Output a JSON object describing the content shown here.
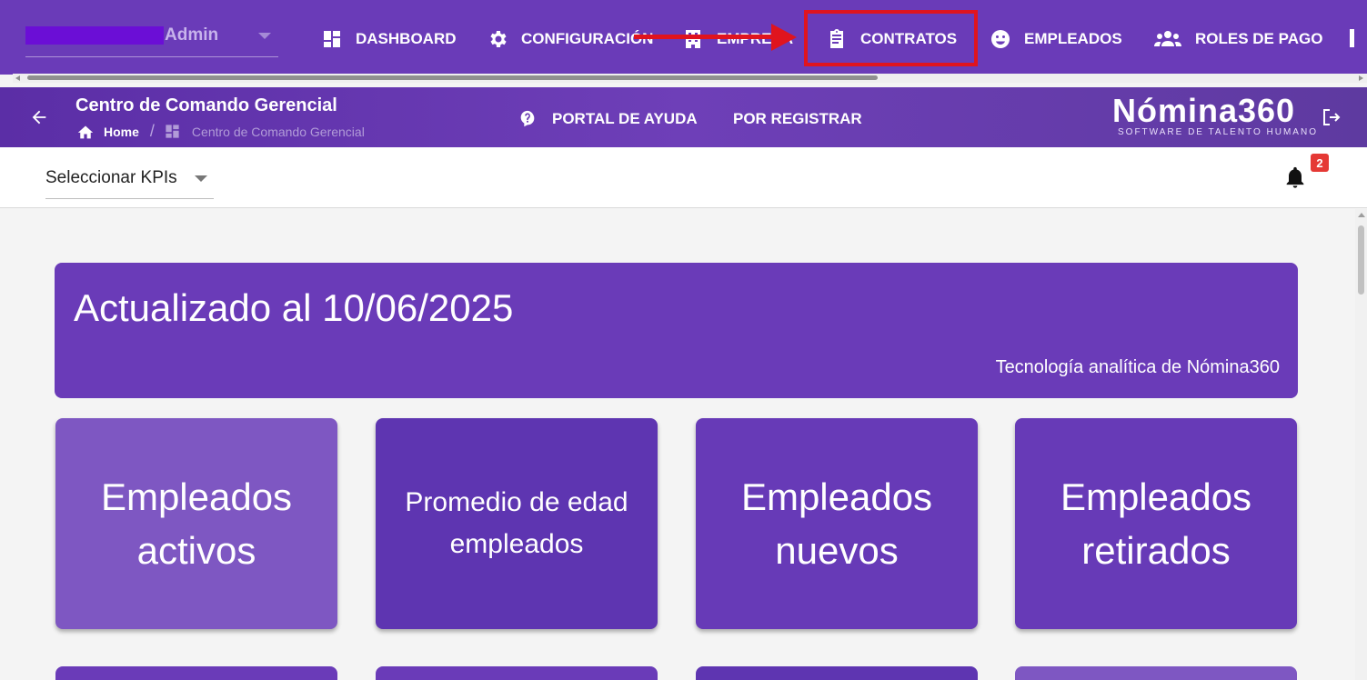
{
  "user": {
    "name": "Admin"
  },
  "nav": {
    "items": [
      {
        "label": "DASHBOARD",
        "icon": "dashboard-icon"
      },
      {
        "label": "CONFIGURACIÓN",
        "icon": "gear-icon"
      },
      {
        "label": "EMPRESA",
        "icon": "building-icon"
      },
      {
        "label": "CONTRATOS",
        "icon": "clipboard-icon"
      },
      {
        "label": "EMPLEADOS",
        "icon": "face-icon"
      },
      {
        "label": "ROLES DE PAGO",
        "icon": "group-icon"
      }
    ]
  },
  "header": {
    "title": "Centro de Comando Gerencial",
    "breadcrumb": {
      "home": "Home",
      "current": "Centro de Comando Gerencial"
    },
    "help_label": "PORTAL DE AYUDA",
    "pending_label": "POR REGISTRAR",
    "brand": "Nómina360",
    "brand_tagline": "SOFTWARE DE TALENTO HUMANO"
  },
  "toolbar": {
    "kpi_select_label": "Seleccionar KPIs",
    "notification_count": "2"
  },
  "banner": {
    "title": "Actualizado al 10/06/2025",
    "subtitle": "Tecnología analítica de Nómina360"
  },
  "cards": [
    {
      "label": "Empleados activos",
      "color": "#7e57c2"
    },
    {
      "label": "Promedio de edad empleados",
      "color": "#5e35b1"
    },
    {
      "label": "Empleados nuevos",
      "color": "#673ab7"
    },
    {
      "label": "Empleados retirados",
      "color": "#673ab7"
    }
  ],
  "colors": {
    "primary": "#6a3bb8",
    "highlight": "#e0141e",
    "badge": "#e53935"
  }
}
